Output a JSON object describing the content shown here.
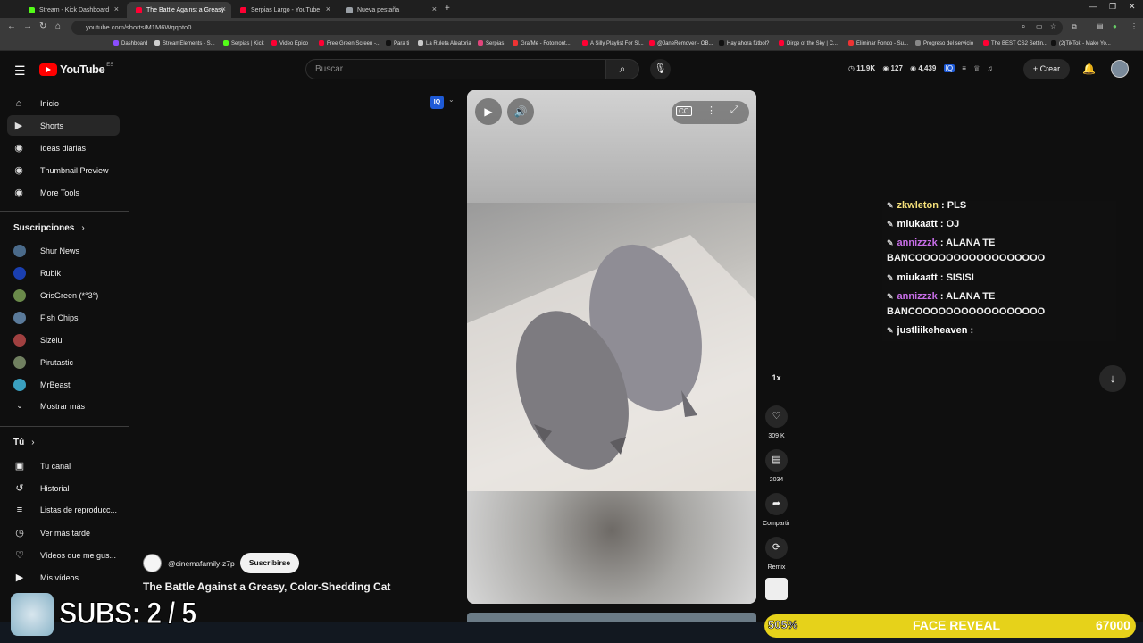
{
  "browser": {
    "tabs": [
      {
        "label": "Stream - Kick Dashboard",
        "color": "#53fc18",
        "active": false
      },
      {
        "label": "The Battle Against a Greasy",
        "color": "#ff0033",
        "active": true
      },
      {
        "label": "Serpias Largo - YouTube",
        "color": "#ff0033",
        "active": false
      },
      {
        "label": "Nueva pestaña",
        "color": "#9aa0a6",
        "active": false
      }
    ],
    "url": "youtube.com/shorts/M1M6Wqqoto0",
    "bookmarks": [
      {
        "label": "Dashboard",
        "color": "#8a4dff"
      },
      {
        "label": "StreamElements - S...",
        "color": "#cfcfcf"
      },
      {
        "label": "Serpias | Kick",
        "color": "#53fc18"
      },
      {
        "label": "Video Epico",
        "color": "#ff0033"
      },
      {
        "label": "Free Green Screen -...",
        "color": "#ff0033"
      },
      {
        "label": "Para ti",
        "color": "#111111"
      },
      {
        "label": "La Ruleta Aleatoria",
        "color": "#c9c9c9"
      },
      {
        "label": "Serpias",
        "color": "#e0457b"
      },
      {
        "label": "GrafMe - Fotomont...",
        "color": "#e33"
      },
      {
        "label": "A Silly Playlist For Sl...",
        "color": "#ff0033"
      },
      {
        "label": "@JaneRemover - OB...",
        "color": "#ff0033"
      },
      {
        "label": "Hay ahora fútbol?",
        "color": "#111111"
      },
      {
        "label": "Dirge of the Sky | C...",
        "color": "#ff0033"
      },
      {
        "label": "Eliminar Fondo - Su...",
        "color": "#e33"
      },
      {
        "label": "Progreso del servicio",
        "color": "#888888"
      },
      {
        "label": "The BEST CS2 Settin...",
        "color": "#ff0033"
      },
      {
        "label": "(2)TikTok - Make Yo...",
        "color": "#111111"
      }
    ]
  },
  "header": {
    "logo": "YouTube",
    "region": "ES",
    "search_placeholder": "Buscar",
    "stats": [
      "11.9K",
      "127",
      "4,439"
    ],
    "create_label": "Crear"
  },
  "sidebar": {
    "main": [
      {
        "label": "Inicio",
        "icon": "home-icon",
        "glyph": "⌂",
        "selected": false
      },
      {
        "label": "Shorts",
        "icon": "shorts-icon",
        "glyph": "▶",
        "selected": true
      },
      {
        "label": "Ideas diarias",
        "icon": "ideas-icon",
        "glyph": "◉",
        "selected": false
      },
      {
        "label": "Thumbnail Preview",
        "icon": "thumbnail-icon",
        "glyph": "◉",
        "selected": false
      },
      {
        "label": "More Tools",
        "icon": "tools-icon",
        "glyph": "◉",
        "selected": false
      }
    ],
    "subs_heading": "Suscripciones",
    "subscriptions": [
      {
        "label": "Shur News",
        "color": "#4a6a8a"
      },
      {
        "label": "Rubik",
        "color": "#1a3fb0"
      },
      {
        "label": "CrisGreen (*°3°)",
        "color": "#6a8a4a"
      },
      {
        "label": "Fish Chips",
        "color": "#5a7a9a"
      },
      {
        "label": "Sizelu",
        "color": "#a04040"
      },
      {
        "label": "Pirutastic",
        "color": "#708060"
      },
      {
        "label": "MrBeast",
        "color": "#3aa0c0"
      }
    ],
    "show_more": "Mostrar más",
    "you_heading": "Tú",
    "you": [
      {
        "label": "Tu canal",
        "glyph": "▣"
      },
      {
        "label": "Historial",
        "glyph": "↺"
      },
      {
        "label": "Listas de reproducc...",
        "glyph": "≡"
      },
      {
        "label": "Ver más tarde",
        "glyph": "◷"
      },
      {
        "label": "Vídeos que me gus...",
        "glyph": "♡"
      },
      {
        "label": "Mis vídeos",
        "glyph": "▶"
      }
    ]
  },
  "short": {
    "channel": "@cinemafamily-z7p",
    "subscribe": "Suscribirse",
    "title": "The Battle Against a Greasy, Color-Shedding Cat",
    "speed": "1x",
    "likes": "309 K",
    "comments": "2034",
    "share": "Compartir",
    "remix": "Remix"
  },
  "chat": [
    {
      "user": "zkwleton",
      "msg": "PLS",
      "color": "#f5e07a"
    },
    {
      "user": "miukaatt",
      "msg": "OJ",
      "color": "#ffffff"
    },
    {
      "user": "annizzzk",
      "msg": "ALANA TE",
      "msg2": "BANCOOOOOOOOOOOOOOOOO",
      "color": "#c86ee8"
    },
    {
      "user": "miukaatt",
      "msg": "SISISI",
      "color": "#ffffff"
    },
    {
      "user": "annizzzk",
      "msg": "ALANA TE",
      "msg2": "BANCOOOOOOOOOOOOOOOOO",
      "color": "#c86ee8"
    },
    {
      "user": "justliikeheaven",
      "msg": "",
      "color": "#ffffff"
    }
  ],
  "overlay": {
    "subs": "SUBS: 2 / 5",
    "goal_percent": "505%",
    "goal_fill_fraction": 1.0,
    "goal_label": "FACE REVEAL",
    "goal_value": "67000",
    "accent": "#e6d21a"
  }
}
